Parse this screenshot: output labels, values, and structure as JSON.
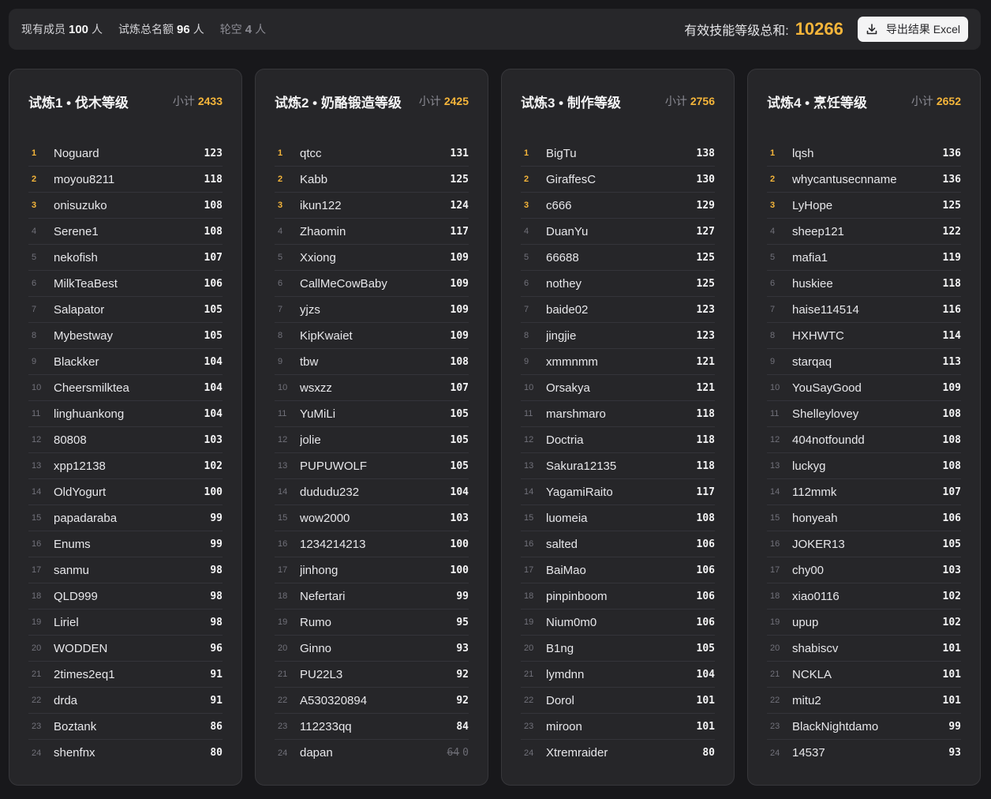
{
  "header": {
    "members_label": "现有成员",
    "members_count": "100",
    "members_unit": "人",
    "quota_label": "试炼总名额",
    "quota_count": "96",
    "quota_unit": "人",
    "bench_label": "轮空",
    "bench_count": "4",
    "bench_unit": "人",
    "total_label": "有效技能等级总和:",
    "total_value": "10266",
    "export_label": "导出结果 Excel",
    "export_icon": "download-icon"
  },
  "accent_color": "#f5b53a",
  "trials": [
    {
      "title": "试炼1 • 伐木等级",
      "subtotal_label": "小计",
      "subtotal": "2433",
      "rows": [
        {
          "rank": "1",
          "name": "Noguard",
          "score": "123"
        },
        {
          "rank": "2",
          "name": "moyou8211",
          "score": "118"
        },
        {
          "rank": "3",
          "name": "onisuzuko",
          "score": "108"
        },
        {
          "rank": "4",
          "name": "Serene1",
          "score": "108"
        },
        {
          "rank": "5",
          "name": "nekofish",
          "score": "107"
        },
        {
          "rank": "6",
          "name": "MilkTeaBest",
          "score": "106"
        },
        {
          "rank": "7",
          "name": "Salapator",
          "score": "105"
        },
        {
          "rank": "8",
          "name": "Mybestway",
          "score": "105"
        },
        {
          "rank": "9",
          "name": "Blackker",
          "score": "104"
        },
        {
          "rank": "10",
          "name": "Cheersmilktea",
          "score": "104"
        },
        {
          "rank": "11",
          "name": "linghuankong",
          "score": "104"
        },
        {
          "rank": "12",
          "name": "80808",
          "score": "103"
        },
        {
          "rank": "13",
          "name": "xpp12138",
          "score": "102"
        },
        {
          "rank": "14",
          "name": "OldYogurt",
          "score": "100"
        },
        {
          "rank": "15",
          "name": "papadaraba",
          "score": "99"
        },
        {
          "rank": "16",
          "name": "Enums",
          "score": "99"
        },
        {
          "rank": "17",
          "name": "sanmu",
          "score": "98"
        },
        {
          "rank": "18",
          "name": "QLD999",
          "score": "98"
        },
        {
          "rank": "19",
          "name": "Liriel",
          "score": "98"
        },
        {
          "rank": "20",
          "name": "WODDEN",
          "score": "96"
        },
        {
          "rank": "21",
          "name": "2times2eq1",
          "score": "91"
        },
        {
          "rank": "22",
          "name": "drda",
          "score": "91"
        },
        {
          "rank": "23",
          "name": "Boztank",
          "score": "86"
        },
        {
          "rank": "24",
          "name": "shenfnx",
          "score": "80"
        }
      ]
    },
    {
      "title": "试炼2 • 奶酪锻造等级",
      "subtotal_label": "小计",
      "subtotal": "2425",
      "rows": [
        {
          "rank": "1",
          "name": "qtcc",
          "score": "131"
        },
        {
          "rank": "2",
          "name": "Kabb",
          "score": "125"
        },
        {
          "rank": "3",
          "name": "ikun122",
          "score": "124"
        },
        {
          "rank": "4",
          "name": "Zhaomin",
          "score": "117"
        },
        {
          "rank": "5",
          "name": "Xxiong",
          "score": "109"
        },
        {
          "rank": "6",
          "name": "CallMeCowBaby",
          "score": "109"
        },
        {
          "rank": "7",
          "name": "yjzs",
          "score": "109"
        },
        {
          "rank": "8",
          "name": "KipKwaiet",
          "score": "109"
        },
        {
          "rank": "9",
          "name": "tbw",
          "score": "108"
        },
        {
          "rank": "10",
          "name": "wsxzz",
          "score": "107"
        },
        {
          "rank": "11",
          "name": "YuMiLi",
          "score": "105"
        },
        {
          "rank": "12",
          "name": "jolie",
          "score": "105"
        },
        {
          "rank": "13",
          "name": "PUPUWOLF",
          "score": "105"
        },
        {
          "rank": "14",
          "name": "dududu232",
          "score": "104"
        },
        {
          "rank": "15",
          "name": "wow2000",
          "score": "103"
        },
        {
          "rank": "16",
          "name": "1234214213",
          "score": "100"
        },
        {
          "rank": "17",
          "name": "jinhong",
          "score": "100"
        },
        {
          "rank": "18",
          "name": "Nefertari",
          "score": "99"
        },
        {
          "rank": "19",
          "name": "Rumo",
          "score": "95"
        },
        {
          "rank": "20",
          "name": "Ginno",
          "score": "93"
        },
        {
          "rank": "21",
          "name": "PU22L3",
          "score": "92"
        },
        {
          "rank": "22",
          "name": "A530320894",
          "score": "92"
        },
        {
          "rank": "23",
          "name": "112233qq",
          "score": "84"
        },
        {
          "rank": "24",
          "name": "dapan",
          "score": "64",
          "strike": true,
          "extra": "0"
        }
      ]
    },
    {
      "title": "试炼3 • 制作等级",
      "subtotal_label": "小计",
      "subtotal": "2756",
      "rows": [
        {
          "rank": "1",
          "name": "BigTu",
          "score": "138"
        },
        {
          "rank": "2",
          "name": "GiraffesC",
          "score": "130"
        },
        {
          "rank": "3",
          "name": "c666",
          "score": "129"
        },
        {
          "rank": "4",
          "name": "DuanYu",
          "score": "127"
        },
        {
          "rank": "5",
          "name": "66688",
          "score": "125"
        },
        {
          "rank": "6",
          "name": "nothey",
          "score": "125"
        },
        {
          "rank": "7",
          "name": "baide02",
          "score": "123"
        },
        {
          "rank": "8",
          "name": "jingjie",
          "score": "123"
        },
        {
          "rank": "9",
          "name": "xmmnmm",
          "score": "121"
        },
        {
          "rank": "10",
          "name": "Orsakya",
          "score": "121"
        },
        {
          "rank": "11",
          "name": "marshmaro",
          "score": "118"
        },
        {
          "rank": "12",
          "name": "Doctria",
          "score": "118"
        },
        {
          "rank": "13",
          "name": "Sakura12135",
          "score": "118"
        },
        {
          "rank": "14",
          "name": "YagamiRaito",
          "score": "117"
        },
        {
          "rank": "15",
          "name": "luomeia",
          "score": "108"
        },
        {
          "rank": "16",
          "name": "salted",
          "score": "106"
        },
        {
          "rank": "17",
          "name": "BaiMao",
          "score": "106"
        },
        {
          "rank": "18",
          "name": "pinpinboom",
          "score": "106"
        },
        {
          "rank": "19",
          "name": "Nium0m0",
          "score": "106"
        },
        {
          "rank": "20",
          "name": "B1ng",
          "score": "105"
        },
        {
          "rank": "21",
          "name": "lymdnn",
          "score": "104"
        },
        {
          "rank": "22",
          "name": "Dorol",
          "score": "101"
        },
        {
          "rank": "23",
          "name": "miroon",
          "score": "101"
        },
        {
          "rank": "24",
          "name": "Xtremraider",
          "score": "80"
        }
      ]
    },
    {
      "title": "试炼4 • 烹饪等级",
      "subtotal_label": "小计",
      "subtotal": "2652",
      "rows": [
        {
          "rank": "1",
          "name": "lqsh",
          "score": "136"
        },
        {
          "rank": "2",
          "name": "whycantusecnname",
          "score": "136"
        },
        {
          "rank": "3",
          "name": "LyHope",
          "score": "125"
        },
        {
          "rank": "4",
          "name": "sheep121",
          "score": "122"
        },
        {
          "rank": "5",
          "name": "mafia1",
          "score": "119"
        },
        {
          "rank": "6",
          "name": "huskiee",
          "score": "118"
        },
        {
          "rank": "7",
          "name": "haise114514",
          "score": "116"
        },
        {
          "rank": "8",
          "name": "HXHWTC",
          "score": "114"
        },
        {
          "rank": "9",
          "name": "starqaq",
          "score": "113"
        },
        {
          "rank": "10",
          "name": "YouSayGood",
          "score": "109"
        },
        {
          "rank": "11",
          "name": "Shelleylovey",
          "score": "108"
        },
        {
          "rank": "12",
          "name": "404notfoundd",
          "score": "108"
        },
        {
          "rank": "13",
          "name": "luckyg",
          "score": "108"
        },
        {
          "rank": "14",
          "name": "112mmk",
          "score": "107"
        },
        {
          "rank": "15",
          "name": "honyeah",
          "score": "106"
        },
        {
          "rank": "16",
          "name": "JOKER13",
          "score": "105"
        },
        {
          "rank": "17",
          "name": "chy00",
          "score": "103"
        },
        {
          "rank": "18",
          "name": "xiao0116",
          "score": "102"
        },
        {
          "rank": "19",
          "name": "upup",
          "score": "102"
        },
        {
          "rank": "20",
          "name": "shabiscv",
          "score": "101"
        },
        {
          "rank": "21",
          "name": "NCKLA",
          "score": "101"
        },
        {
          "rank": "22",
          "name": "mitu2",
          "score": "101"
        },
        {
          "rank": "23",
          "name": "BlackNightdamo",
          "score": "99"
        },
        {
          "rank": "24",
          "name": "14537",
          "score": "93"
        }
      ]
    }
  ]
}
